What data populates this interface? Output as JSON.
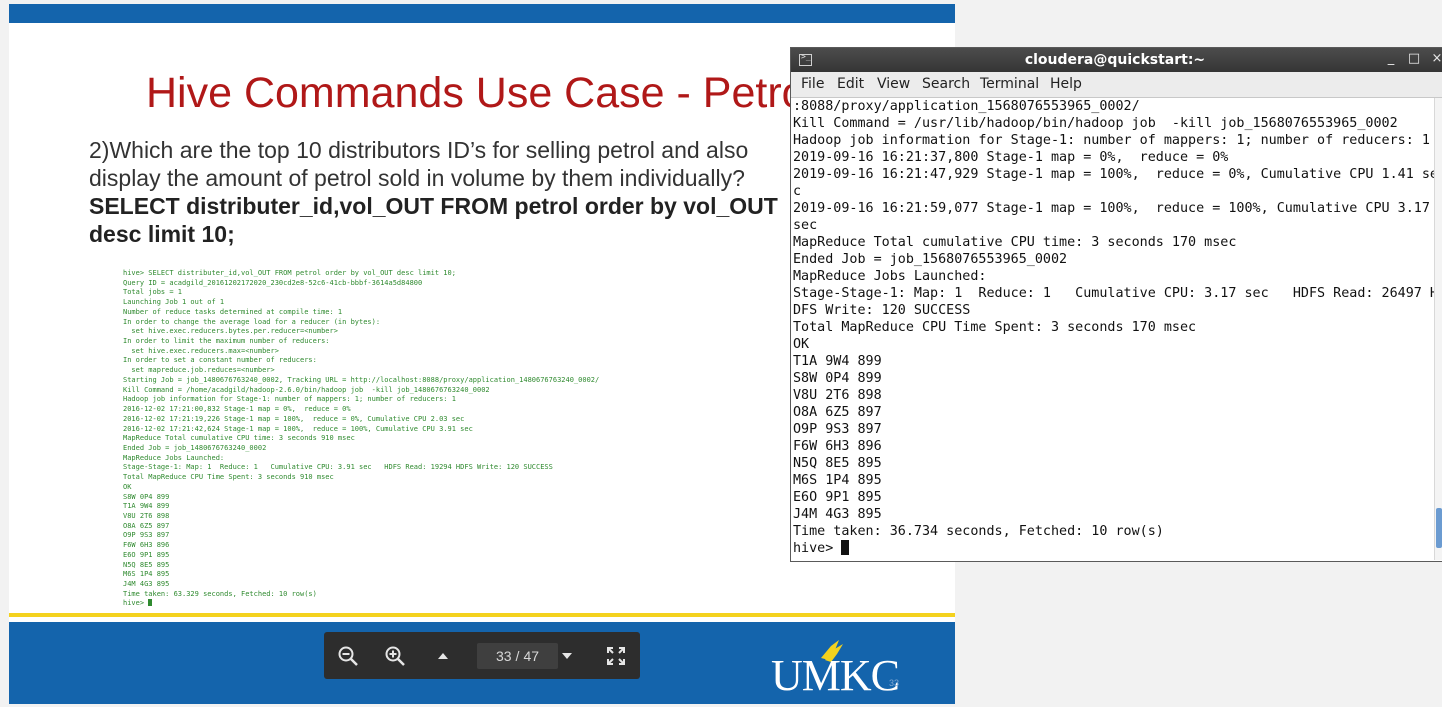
{
  "slide": {
    "title": "Hive Commands Use Case - Petrol",
    "question": "2)Which are the top 10 distributors ID’s for selling petrol and also display the amount of petrol sold in volume by them individually?",
    "sql": "SELECT distributer_id,vol_OUT FROM petrol order by vol_OUT desc limit 10;",
    "logo_text": "UMKC",
    "slide_number": "33",
    "terminal_lines": [
      "hive> SELECT distributer_id,vol_OUT FROM petrol order by vol_OUT desc limit 10;",
      "Query ID = acadgild_20161202172020_230cd2e8-52c6-41cb-bbbf-3614a5d84800",
      "Total jobs = 1",
      "Launching Job 1 out of 1",
      "Number of reduce tasks determined at compile time: 1",
      "In order to change the average load for a reducer (in bytes):",
      "  set hive.exec.reducers.bytes.per.reducer=<number>",
      "In order to limit the maximum number of reducers:",
      "  set hive.exec.reducers.max=<number>",
      "In order to set a constant number of reducers:",
      "  set mapreduce.job.reduces=<number>",
      "Starting Job = job_1480676763240_0002, Tracking URL = http://localhost:8088/proxy/application_1480676763240_0002/",
      "Kill Command = /home/acadgild/hadoop-2.6.0/bin/hadoop job  -kill job_1480676763240_0002",
      "Hadoop job information for Stage-1: number of mappers: 1; number of reducers: 1",
      "2016-12-02 17:21:00,832 Stage-1 map = 0%,  reduce = 0%",
      "2016-12-02 17:21:19,226 Stage-1 map = 100%,  reduce = 0%, Cumulative CPU 2.03 sec",
      "2016-12-02 17:21:42,624 Stage-1 map = 100%,  reduce = 100%, Cumulative CPU 3.91 sec",
      "MapReduce Total cumulative CPU time: 3 seconds 910 msec",
      "Ended Job = job_1480676763240_0002",
      "MapReduce Jobs Launched:",
      "Stage-Stage-1: Map: 1  Reduce: 1   Cumulative CPU: 3.91 sec   HDFS Read: 19294 HDFS Write: 120 SUCCESS",
      "Total MapReduce CPU Time Spent: 3 seconds 910 msec",
      "OK",
      "S8W 0P4 899",
      "T1A 9W4 899",
      "V8U 2T6 898",
      "O8A 6Z5 897",
      "O9P 9S3 897",
      "F6W 6H3 896",
      "E6O 9P1 895",
      "N5Q 8E5 895",
      "M6S 1P4 895",
      "J4M 4G3 895",
      "Time taken: 63.329 seconds, Fetched: 10 row(s)"
    ],
    "terminal_prompt": "hive> "
  },
  "pdf_toolbar": {
    "current_page": "33",
    "separator": "/",
    "total_pages": "47",
    "icons": [
      "zoom-out-icon",
      "zoom-in-icon",
      "page-up-icon",
      "page-down-icon",
      "fullscreen-icon"
    ]
  },
  "terminal": {
    "title": "cloudera@quickstart:~",
    "window_controls": [
      "_",
      "□",
      "×"
    ],
    "menu": [
      "File",
      "Edit",
      "View",
      "Search",
      "Terminal",
      "Help"
    ],
    "lines": [
      ":8088/proxy/application_1568076553965_0002/",
      "Kill Command = /usr/lib/hadoop/bin/hadoop job  -kill job_1568076553965_0002",
      "Hadoop job information for Stage-1: number of mappers: 1; number of reducers: 1",
      "2019-09-16 16:21:37,800 Stage-1 map = 0%,  reduce = 0%",
      "2019-09-16 16:21:47,929 Stage-1 map = 100%,  reduce = 0%, Cumulative CPU 1.41 se",
      "c",
      "2019-09-16 16:21:59,077 Stage-1 map = 100%,  reduce = 100%, Cumulative CPU 3.17",
      "sec",
      "MapReduce Total cumulative CPU time: 3 seconds 170 msec",
      "Ended Job = job_1568076553965_0002",
      "MapReduce Jobs Launched:",
      "Stage-Stage-1: Map: 1  Reduce: 1   Cumulative CPU: 3.17 sec   HDFS Read: 26497 H",
      "DFS Write: 120 SUCCESS",
      "Total MapReduce CPU Time Spent: 3 seconds 170 msec",
      "OK",
      "T1A 9W4 899",
      "S8W 0P4 899",
      "V8U 2T6 898",
      "O8A 6Z5 897",
      "O9P 9S3 897",
      "F6W 6H3 896",
      "N5Q 8E5 895",
      "M6S 1P4 895",
      "E6O 9P1 895",
      "J4M 4G3 895",
      "Time taken: 36.734 seconds, Fetched: 10 row(s)"
    ],
    "prompt": "hive> "
  },
  "colors": {
    "slide_blue": "#1464ac",
    "title_red": "#b01818",
    "accent_yellow": "#f4d21e",
    "mini_terminal_green": "#2f8a2f"
  }
}
